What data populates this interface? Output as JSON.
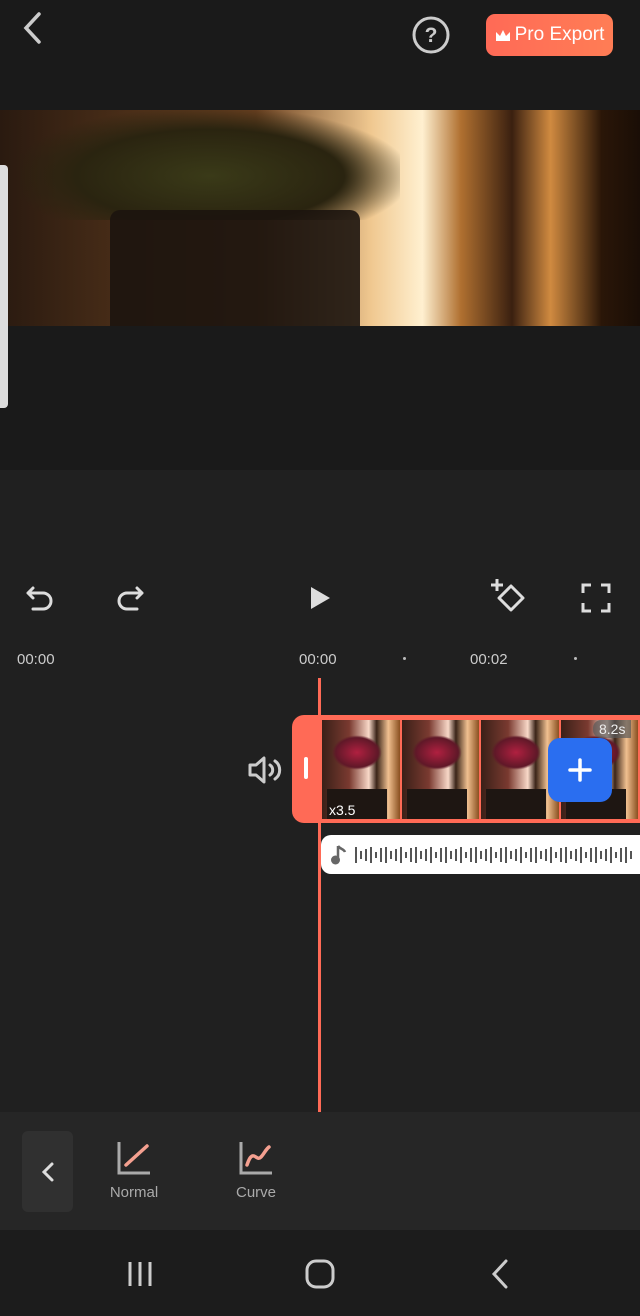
{
  "header": {
    "back_icon": "chevron-left-icon",
    "help_icon": "question-circle-icon",
    "pro_export_label": "Pro Export",
    "pro_export_icon": "crown-icon",
    "accent": "#ff6a56"
  },
  "controls": {
    "undo": "undo-icon",
    "redo": "redo-icon",
    "play": "play-icon",
    "keyframe": "add-keyframe-icon",
    "fullscreen": "fullscreen-icon"
  },
  "timeline": {
    "current_time": "00:00",
    "ruler": [
      "00:00",
      "00:02"
    ],
    "clip": {
      "speed": "x3.5",
      "duration": "8.2s"
    },
    "add_color": "#2a6ef0"
  },
  "toolbar": {
    "modes": [
      {
        "label": "Normal",
        "icon": "linear-speed-icon"
      },
      {
        "label": "Curve",
        "icon": "curve-speed-icon"
      }
    ]
  },
  "navbar": {
    "recents": "recents-icon",
    "home": "home-icon",
    "back": "back-icon"
  }
}
